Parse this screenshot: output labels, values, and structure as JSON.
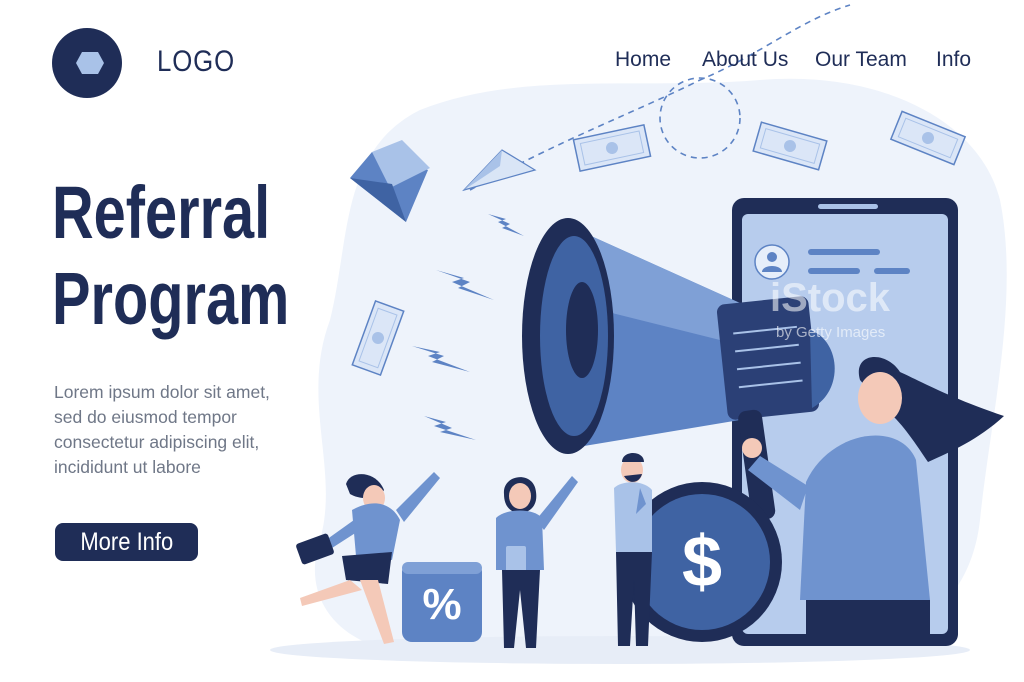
{
  "header": {
    "logo_label": "LOGO",
    "nav": [
      "Home",
      "About Us",
      "Our Team",
      "Info"
    ]
  },
  "hero": {
    "title_lines": [
      "Referral",
      "Program"
    ],
    "body_lines": [
      "Lorem ipsum dolor sit amet,",
      "sed do eiusmod tempor",
      "consectetur adipiscing elit,",
      "incididunt ut labore"
    ],
    "cta_label": "More Info"
  },
  "illustration": {
    "percent_symbol": "%",
    "dollar_symbol": "$"
  },
  "watermark": {
    "brand": "iStock",
    "credit": "by Getty Images"
  },
  "colors": {
    "navy": "#1f2d57",
    "blue": "#5d83c4",
    "light_blue": "#a9c2e8",
    "pale_blue": "#eef3fb",
    "text_gray": "#6f7787"
  },
  "icons": [
    "logo-hexagon-icon",
    "megaphone-icon",
    "smartphone-icon",
    "envelope-icon",
    "paper-plane-icon",
    "banknote-icon",
    "lightning-icon",
    "percent-icon",
    "dollar-coin-icon",
    "user-avatar-icon"
  ]
}
